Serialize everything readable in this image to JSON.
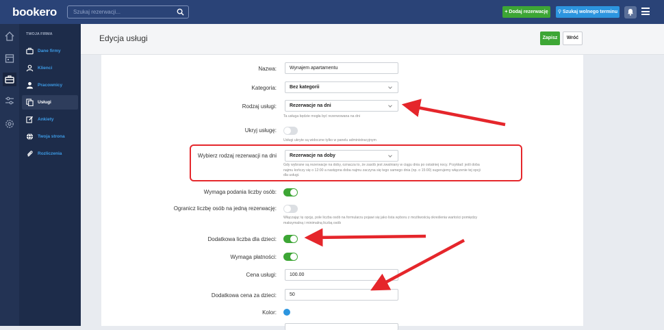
{
  "brand": {
    "logo": "bookero"
  },
  "topbar": {
    "search_placeholder": "Szukaj rezerwacji...",
    "add_reservation": "+ Dodaj rezerwację",
    "find_slot": "Szukaj wolnego terminu"
  },
  "sidebar": {
    "section": "TWOJA FIRMA",
    "items": [
      {
        "label": "Dane firmy",
        "icon": "briefcase-icon"
      },
      {
        "label": "Klienci",
        "icon": "person-outline-icon"
      },
      {
        "label": "Pracownicy",
        "icon": "person-icon"
      },
      {
        "label": "Usługi",
        "icon": "copy-icon",
        "active": true
      },
      {
        "label": "Ankiety",
        "icon": "edit-icon"
      },
      {
        "label": "Twoja strona",
        "icon": "globe-icon"
      },
      {
        "label": "Rozliczenia",
        "icon": "paperclip-icon"
      }
    ]
  },
  "page": {
    "title": "Edycja usługi",
    "save": "Zapisz",
    "back": "Wróć"
  },
  "form": {
    "name": {
      "label": "Nazwa:",
      "value": "Wynajem apartamentu"
    },
    "category": {
      "label": "Kategoria:",
      "value": "Bez kategorii"
    },
    "service_type": {
      "label": "Rodzaj usługi:",
      "value": "Rezerwacje na dni",
      "help": "Ta usługa będzie mogła być rezerwowana na dni"
    },
    "hide": {
      "label": "Ukryj usługę:",
      "on": false,
      "help": "Usługi ukryte są widoczne tylko w panelu administracyjnym"
    },
    "day_type": {
      "label": "Wybierz rodzaj rezerwacji na dni",
      "value": "Rezerwacje na doby",
      "help1": "Gdy wybrane są rezerwacje na doby, oznacza to, że zasób jest zwalniany w ciągu dnia po ostatniej nocy. Przykład: jeśli doba",
      "help2": "najmu kończy się o 12:00 a następna doba najmu zaczyna się tego samego dnia (np. o 15:00) sugerujemy włączenie tej opcji",
      "help3": "dla usługi."
    },
    "require_persons": {
      "label": "Wymaga podania liczby osób:",
      "on": true
    },
    "limit_persons": {
      "label": "Ogranicz liczbę osób na jedną rezerwację:",
      "on": false,
      "help1": "Włączając tę opcję, pole liczba osób na formularzu pojawi się jako lista wyboru z możliwością określenia wartości pomiędzy",
      "help2": "maksymalną i minimalną liczbą osób"
    },
    "children": {
      "label": "Dodatkowa liczba dla dzieci:",
      "on": true
    },
    "payment": {
      "label": "Wymaga płatności:",
      "on": true
    },
    "price": {
      "label": "Cena usługi:",
      "value": "100.00"
    },
    "child_price": {
      "label": "Dodatkowa cena za dzieci:",
      "value": "50"
    },
    "color": {
      "label": "Kolor:",
      "value": "#2c95df"
    }
  }
}
